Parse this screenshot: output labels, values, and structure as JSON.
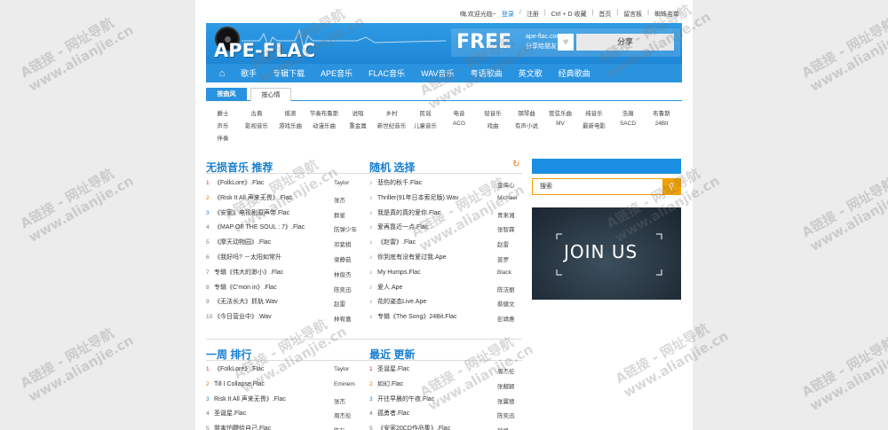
{
  "toplinks": [
    "嗨,欢迎光临~",
    "登录",
    "注册",
    "Ctrl + D 收藏",
    "首页",
    "留言板",
    "蜘蛛名单"
  ],
  "banner": {
    "logo": "APE-FLAC",
    "free": "FREE",
    "free_sub1": "ape-flac.com",
    "free_sub2": "分享给朋友",
    "share": "分享"
  },
  "nav": [
    "歌手",
    "专辑下载",
    "APE音乐",
    "FLAC音乐",
    "WAV音乐",
    "粤语歌曲",
    "英文歌",
    "经典歌曲"
  ],
  "tabs": [
    "按曲风",
    "按心情"
  ],
  "tags": [
    [
      "爵士",
      "古典",
      "摇滚",
      "节奏布鲁斯",
      "说唱",
      "乡村",
      "民谣",
      "电音",
      "轻音乐",
      "钢琴曲",
      "管弦乐曲",
      "纯音乐",
      "浩瀚",
      "布鲁斯"
    ],
    [
      "声乐",
      "影视音乐",
      "游戏乐曲",
      "动漫乐曲",
      "重金属",
      "新世纪音乐",
      "儿童音乐",
      "ACG",
      "戏曲",
      "有声小说",
      "MV",
      "最新电影",
      "SACD",
      "24Bit"
    ],
    [
      "伴奏"
    ]
  ],
  "sections": {
    "lossless": {
      "title": "无损音乐 推荐",
      "rows": [
        {
          "n": "1",
          "song": "《FolkLore》.Flac",
          "artist": "Taylor"
        },
        {
          "n": "2",
          "song": "《Risk It All 声来无畏》.Flac",
          "artist": "张杰"
        },
        {
          "n": "3",
          "song": "《安家》电视剧原声带.Flac",
          "artist": "群星"
        },
        {
          "n": "4",
          "song": "《MAP OF THE SOUL : 7》.Flac",
          "artist": "防弹少年"
        },
        {
          "n": "5",
          "song": "《摩天动物园》.Flac",
          "artist": "邓紫棋"
        },
        {
          "n": "6",
          "song": "《我好吗? －太阳如常升",
          "artist": "梁静茹"
        },
        {
          "n": "7",
          "song": "专辑《伟大的渺小》.Flac",
          "artist": "林俊杰"
        },
        {
          "n": "8",
          "song": "专辑《C'mon in》.Flac",
          "artist": "陈奕迅"
        },
        {
          "n": "9",
          "song": "《无法长大》抓轨.Wav",
          "artist": "赵雷"
        },
        {
          "n": "10",
          "song": "《今日营业中》.Wav",
          "artist": "林宥嘉"
        }
      ]
    },
    "random": {
      "title": "随机 选择",
      "rows": [
        {
          "song": "悲伤的秋千.Flac",
          "artist": "金海心"
        },
        {
          "song": "Thriller(91年日本索尼版).Wav",
          "artist": "Michael"
        },
        {
          "song": "我是真的真的爱你.Flac",
          "artist": "青来湘"
        },
        {
          "song": "爱再靠近一点.Flac",
          "artist": "张智霖"
        },
        {
          "song": "《赵雷》.Flac",
          "artist": "赵雷"
        },
        {
          "song": "你到底有没有爱过我.Ape",
          "artist": "普罗"
        },
        {
          "song": "My Humps.Flac",
          "artist": "Black"
        },
        {
          "song": "爱人.Ape",
          "artist": "陈洁丽"
        },
        {
          "song": "花的姿态Live.Ape",
          "artist": "蔡健文"
        },
        {
          "song": "专辑《The Song》24Bit.Flac",
          "artist": "彭靖惠"
        }
      ]
    },
    "weekly": {
      "title": "一周 排行",
      "rows": [
        {
          "n": "1",
          "song": "《FolkLore》.Flac",
          "artist": "Taylor"
        },
        {
          "n": "2",
          "song": "Till I Collapse.Flac",
          "artist": "Eminem"
        },
        {
          "n": "3",
          "song": "Risk It All 声来无畏》.Flac",
          "artist": "张杰"
        },
        {
          "n": "4",
          "song": "圣诞星.Flac",
          "artist": "周杰伦"
        },
        {
          "n": "5",
          "song": "我害怕鞭给自己.Flac",
          "artist": "陈升"
        }
      ]
    },
    "latest": {
      "title": "最近 更新",
      "rows": [
        {
          "n": "1",
          "song": "圣诞星.Flac",
          "artist": "周杰伦"
        },
        {
          "n": "2",
          "song": "如幻.Flac",
          "artist": "张靓颖"
        },
        {
          "n": "3",
          "song": "开往早晨的午夜.Flac",
          "artist": "张翼德"
        },
        {
          "n": "4",
          "song": "孤勇者.Flac",
          "artist": "陈奕迅"
        },
        {
          "n": "5",
          "song": "《安家20CD作品集》.Flac",
          "artist": "瑞格"
        }
      ]
    }
  },
  "right": {
    "search_label": "搜索",
    "join": "JOIN US"
  },
  "watermarks": [
    "A链接 - 网址导航",
    "www.alianjie.cn"
  ]
}
